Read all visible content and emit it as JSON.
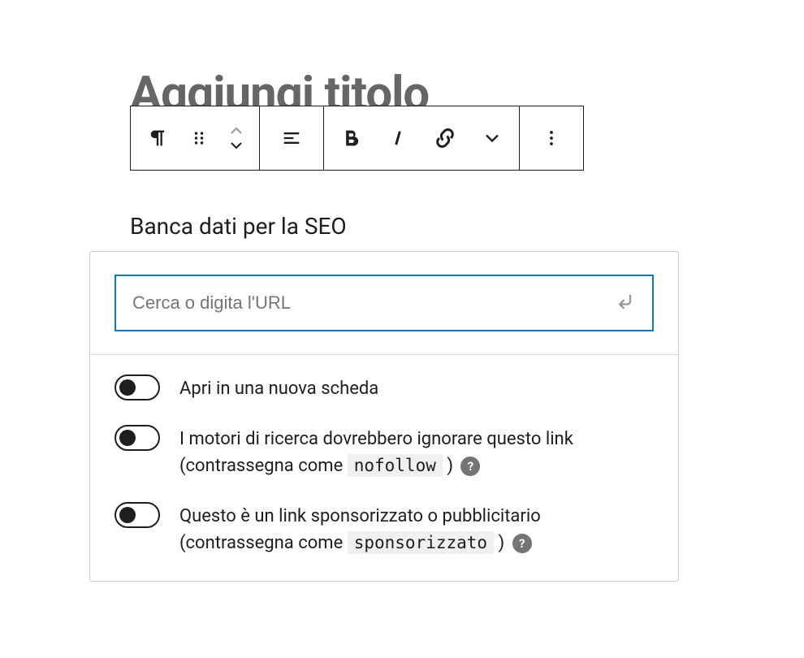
{
  "title": {
    "placeholder": "Aggiungi titolo"
  },
  "content": {
    "text": "Banca dati per la SEO"
  },
  "linkPanel": {
    "searchPlaceholder": "Cerca o digita l'URL",
    "options": {
      "newTab": {
        "label": "Apri in una nuova scheda"
      },
      "nofollow": {
        "labelPrefix": "I motori di ricerca dovrebbero ignorare questo link (contrassegna come ",
        "code": "nofollow",
        "labelSuffix": " )"
      },
      "sponsored": {
        "labelPrefix": "Questo è un link sponsorizzato o pubblicitario (contrassegna come ",
        "code": "sponsorizzato",
        "labelSuffix": " )"
      }
    }
  },
  "icons": {
    "help": "?"
  }
}
